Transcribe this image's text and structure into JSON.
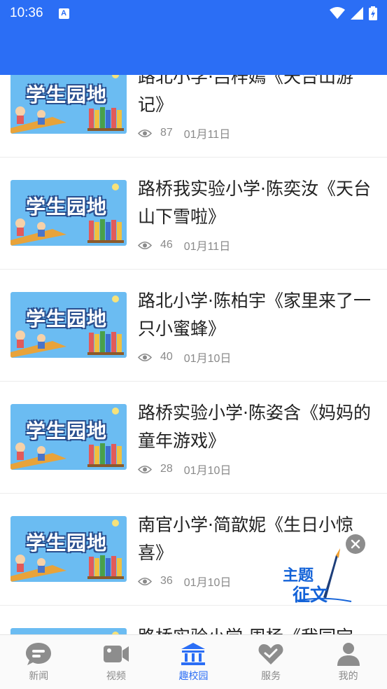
{
  "status_bar": {
    "time": "10:36",
    "notification_icon": "A",
    "icons": [
      "wifi-icon",
      "signal-icon",
      "battery-icon"
    ]
  },
  "colors": {
    "header": "#2b6ef5",
    "tab_active": "#2b6ef5",
    "tab_inactive": "#8a8a8a"
  },
  "thumbnail_caption": "学生园地",
  "articles": [
    {
      "title": "路北小学·吕梓嫣《天台山游记》",
      "views": "87",
      "date": "01月11日"
    },
    {
      "title": "路桥我实验小学·陈奕汝《天台山下雪啦》",
      "views": "46",
      "date": "01月11日"
    },
    {
      "title": "路北小学·陈柏宇《家里来了一只小蜜蜂》",
      "views": "40",
      "date": "01月10日"
    },
    {
      "title": "路桥实验小学·陈姿含《妈妈的童年游戏》",
      "views": "28",
      "date": "01月10日"
    },
    {
      "title": "南官小学·简歆妮《生日小惊喜》",
      "views": "36",
      "date": "01月10日"
    },
    {
      "title": "路桥实验小学·周杨《我园宝",
      "views": "",
      "date": ""
    }
  ],
  "floating_badge": {
    "line1": "主题",
    "line2": "征文",
    "icon": "pen-icon"
  },
  "tabs": [
    {
      "label": "新闻",
      "icon": "chat-bubble-icon",
      "active": false
    },
    {
      "label": "视频",
      "icon": "video-camera-icon",
      "active": false
    },
    {
      "label": "趣校园",
      "icon": "school-building-icon",
      "active": true
    },
    {
      "label": "服务",
      "icon": "heart-hands-icon",
      "active": false
    },
    {
      "label": "我的",
      "icon": "user-icon",
      "active": false
    }
  ]
}
